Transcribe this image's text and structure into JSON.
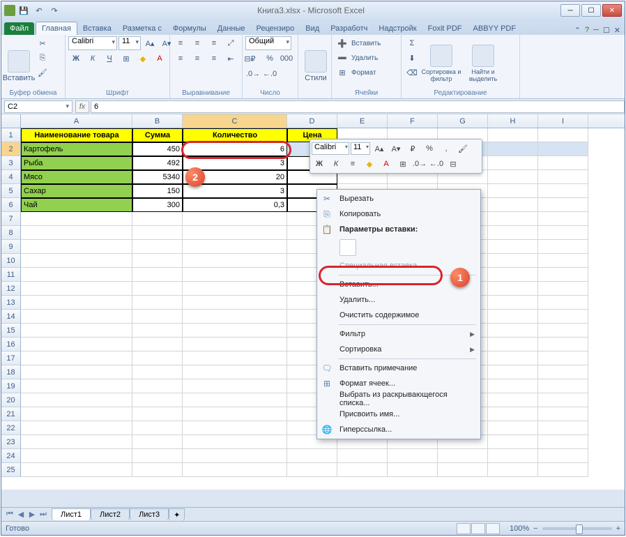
{
  "window": {
    "title": "Книга3.xlsx - Microsoft Excel"
  },
  "ribbon_tabs": {
    "file": "Файл",
    "home": "Главная",
    "insert": "Вставка",
    "layout": "Разметка с",
    "formulas": "Формулы",
    "data": "Данные",
    "review": "Рецензиро",
    "view": "Вид",
    "developer": "Разработч",
    "addins": "Надстройк",
    "foxit": "Foxit PDF",
    "abbyy": "ABBYY PDF"
  },
  "ribbon_groups": {
    "clipboard": "Буфер обмена",
    "font": "Шрифт",
    "alignment": "Выравнивание",
    "number": "Число",
    "styles": "Стили",
    "cells": "Ячейки",
    "editing": "Редактирование"
  },
  "ribbon_btns": {
    "paste": "Вставить",
    "insert": "Вставить",
    "delete": "Удалить",
    "format": "Формат",
    "sort": "Сортировка и фильтр",
    "find": "Найти и выделить",
    "styles": "Стили"
  },
  "font": {
    "name": "Calibri",
    "size": "11",
    "number_format": "Общий"
  },
  "namebox": "C2",
  "formula": "6",
  "columns": [
    "A",
    "B",
    "C",
    "D",
    "E",
    "F",
    "G",
    "H",
    "I"
  ],
  "table": {
    "headers": {
      "name": "Наименование товара",
      "sum": "Сумма",
      "qty": "Количество",
      "price": "Цена"
    },
    "rows": [
      {
        "name": "Картофель",
        "sum": "450",
        "qty": "6"
      },
      {
        "name": "Рыба",
        "sum": "492",
        "qty": "3"
      },
      {
        "name": "Мясо",
        "sum": "5340",
        "qty": "20"
      },
      {
        "name": "Сахар",
        "sum": "150",
        "qty": "3"
      },
      {
        "name": "Чай",
        "sum": "300",
        "qty": "0,3"
      }
    ]
  },
  "mini": {
    "font": "Calibri",
    "size": "11"
  },
  "ctx": {
    "cut": "Вырезать",
    "copy": "Копировать",
    "paste_opts": "Параметры вставки:",
    "paste_special": "Специальная вставка...",
    "insert": "Вставить...",
    "delete": "Удалить...",
    "clear": "Очистить содержимое",
    "filter": "Фильтр",
    "sort": "Сортировка",
    "comment": "Вставить примечание",
    "format": "Формат ячеек...",
    "dropdown": "Выбрать из раскрывающегося списка...",
    "define_name": "Присвоить имя...",
    "hyperlink": "Гиперссылка..."
  },
  "sheets": {
    "s1": "Лист1",
    "s2": "Лист2",
    "s3": "Лист3"
  },
  "status": {
    "ready": "Готово",
    "zoom": "100%"
  },
  "callouts": {
    "one": "1",
    "two": "2"
  }
}
